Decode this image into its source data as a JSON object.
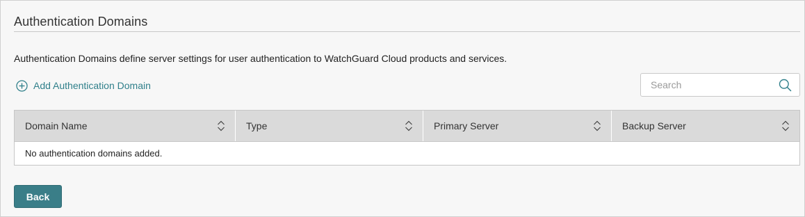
{
  "page": {
    "title": "Authentication Domains",
    "description": "Authentication Domains define server settings for user authentication to WatchGuard Cloud products and services."
  },
  "actions": {
    "add_label": "Add Authentication Domain",
    "add_icon": "plus-circle-icon",
    "back_label": "Back"
  },
  "search": {
    "placeholder": "Search",
    "value": "",
    "icon": "search-icon"
  },
  "table": {
    "columns": [
      {
        "label": "Domain Name",
        "sort_icon": "sort-icon"
      },
      {
        "label": "Type",
        "sort_icon": "sort-icon"
      },
      {
        "label": "Primary Server",
        "sort_icon": "sort-icon"
      },
      {
        "label": "Backup Server",
        "sort_icon": "sort-icon"
      }
    ],
    "empty_message": "No authentication domains added."
  },
  "colors": {
    "accent": "#3a7e88",
    "link": "#2f7f8a",
    "header_bg": "#dadada",
    "page_bg": "#f7f7f7"
  }
}
